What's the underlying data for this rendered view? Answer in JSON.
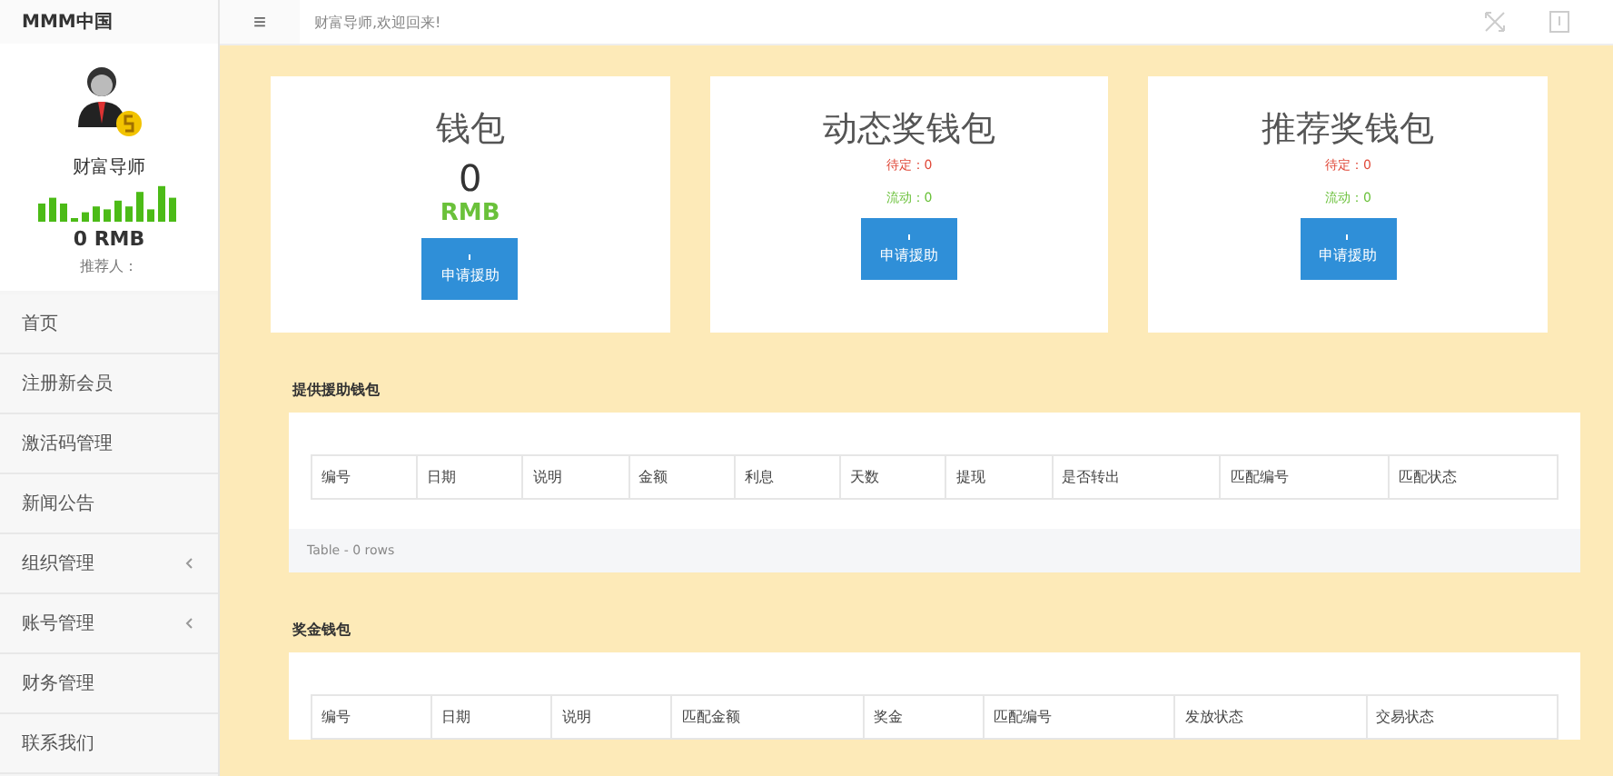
{
  "brand": "MMM中国",
  "topbar": {
    "menu_glyph": "≡",
    "welcome": "财富导师,欢迎回来!"
  },
  "profile": {
    "name": "财富导师",
    "balance": "0 RMB",
    "referrer": "推荐人："
  },
  "sidebar": {
    "items": [
      {
        "label": "首页",
        "expandable": false
      },
      {
        "label": "注册新会员",
        "expandable": false
      },
      {
        "label": "激活码管理",
        "expandable": false
      },
      {
        "label": "新闻公告",
        "expandable": false
      },
      {
        "label": "组织管理",
        "expandable": true
      },
      {
        "label": "账号管理",
        "expandable": true
      },
      {
        "label": "财务管理",
        "expandable": false
      },
      {
        "label": "联系我们",
        "expandable": false
      }
    ]
  },
  "cards": [
    {
      "kind": "main",
      "title": "钱包",
      "amount": "0",
      "currency": "RMB",
      "button": "申请援助"
    },
    {
      "kind": "bonus",
      "title": "动态奖钱包",
      "pending": "待定：0",
      "active": "流动：0",
      "button": "申请援助"
    },
    {
      "kind": "bonus",
      "title": "推荐奖钱包",
      "pending": "待定：0",
      "active": "流动：0",
      "button": "申请援助"
    }
  ],
  "sections": [
    {
      "title": "提供援助钱包",
      "columns": [
        "编号",
        "日期",
        "说明",
        "金额",
        "利息",
        "天数",
        "提现",
        "是否转出",
        "匹配编号",
        "匹配状态"
      ],
      "footer": "Table - 0 rows"
    },
    {
      "title": "奖金钱包",
      "columns": [
        "编号",
        "日期",
        "说明",
        "匹配金额",
        "奖金",
        "匹配编号",
        "发放状态",
        "交易状态"
      ]
    }
  ]
}
